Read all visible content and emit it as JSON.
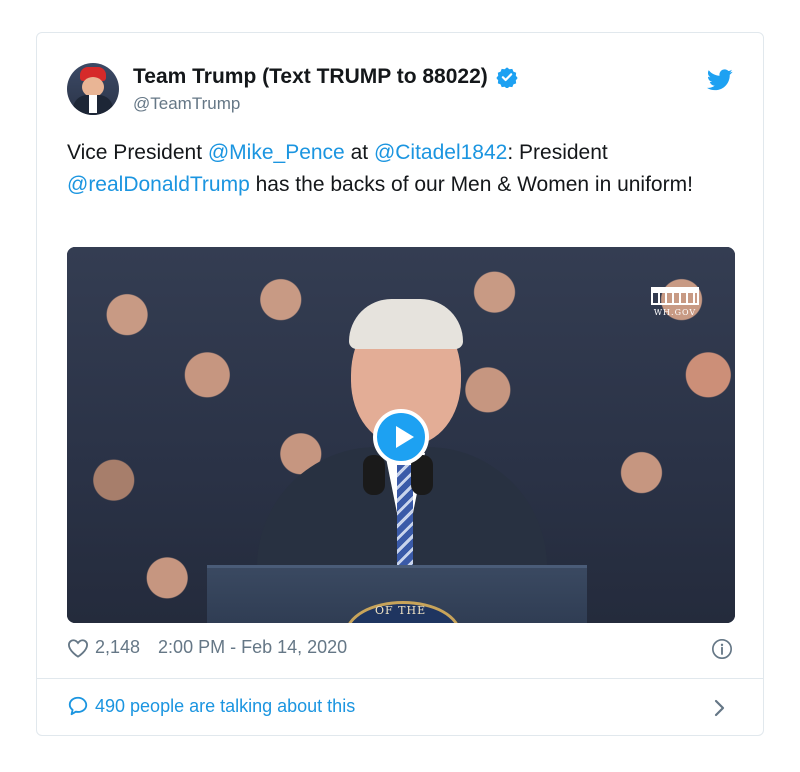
{
  "tweet": {
    "display_name": "Team Trump (Text TRUMP to 88022)",
    "handle": "@TeamTrump",
    "text_parts": {
      "p1": "Vice President ",
      "m1": "@Mike_Pence",
      "p2": " at ",
      "m2": "@Citadel1842",
      "p3": ": President ",
      "m3": "@realDonaldTrump",
      "p4": " has the backs of our Men & Women in uniform!"
    },
    "video": {
      "watermark": "WH.GOV",
      "seal_text": "OF THE"
    },
    "likes": "2,148",
    "timestamp": "2:00 PM - Feb 14, 2020",
    "talking": "490 people are talking about this"
  },
  "colors": {
    "accent": "#1b95e0",
    "verified": "#1da1f2",
    "muted": "#657786",
    "border": "#e1e8ed"
  },
  "icons": [
    "verified-badge-icon",
    "twitter-bird-icon",
    "play-icon",
    "heart-icon",
    "info-icon",
    "speech-bubble-icon",
    "chevron-right-icon"
  ]
}
